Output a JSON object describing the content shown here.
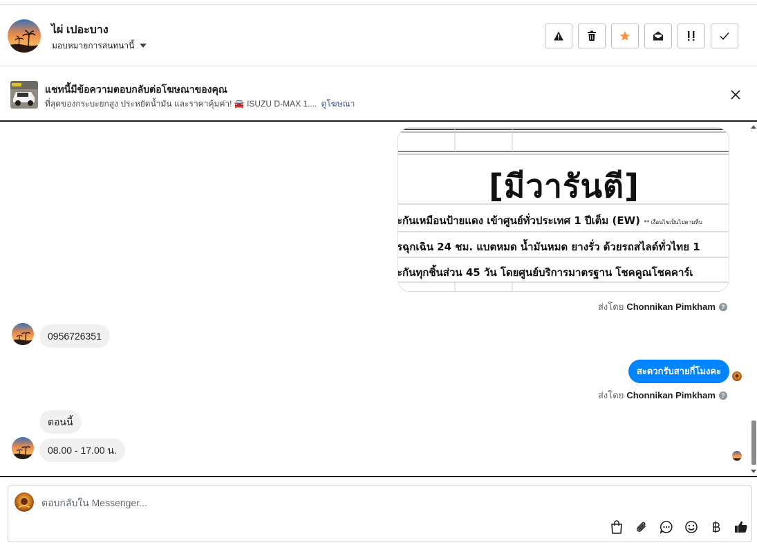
{
  "header": {
    "contact_name": "ไผ่ เปอะบาง",
    "assign_label": "มอบหมายการสนทนานี้",
    "actions": [
      {
        "name": "report-spam-button",
        "icon": "warning-icon"
      },
      {
        "name": "delete-button",
        "icon": "trash-icon"
      },
      {
        "name": "star-button",
        "icon": "star-icon"
      },
      {
        "name": "mark-unread-button",
        "icon": "envelope-open-icon"
      },
      {
        "name": "mark-important-button",
        "icon": "follow-up-icon"
      },
      {
        "name": "mark-done-button",
        "icon": "check-icon"
      }
    ],
    "star_color": "#f7923b"
  },
  "ad": {
    "title": "แชทนี้มีข้อความตอบกลับต่อโฆษณาของคุณ",
    "description": "ที่สุดของกระบะยกสูง ประหยัดน้ำมัน และราคาคุ้มค่า! 🚘 ISUZU D-MAX 1....",
    "link": "ดูโฆษณา"
  },
  "conversation": {
    "image_message": {
      "headline": "[มีวารันตี]",
      "lines": [
        "ะกันเหมือนป้ายแดง เข้าศูนย์ทั่วประเทศ 1 ปีเต็ม (EW)",
        "รฉุกเฉิน 24 ชม. แบตหมด น้ำมันหมด ยางรั่ว ด้วยรถสไลด์ทั่วไทย 1",
        "ะกันทุกชิ้นส่วน 45 วัน โดยศูนย์บริการมาตรฐาน โชคคูณโชคคาร์เ"
      ],
      "small_note": "** เงื่อนไขเป็นไปตามที่บ"
    },
    "sent_by_prefix": "ส่งโดย",
    "sent_by_name": "Chonnikan Pimkham",
    "messages": [
      {
        "direction": "in",
        "text": "0956726351"
      },
      {
        "direction": "out",
        "text": "สะดวกรับสายกี่โมงคะ"
      },
      {
        "direction": "in",
        "text": "ตอนนี้"
      },
      {
        "direction": "in",
        "text": "08.00 - 17.00 น."
      }
    ],
    "outgoing_color": "#0084ff"
  },
  "composer": {
    "placeholder": "ตอบกลับใน Messenger...",
    "tools": [
      "shopping-bag-icon",
      "paperclip-icon",
      "saved-reply-icon",
      "emoji-icon",
      "baht-icon",
      "thumbs-up-icon"
    ]
  }
}
